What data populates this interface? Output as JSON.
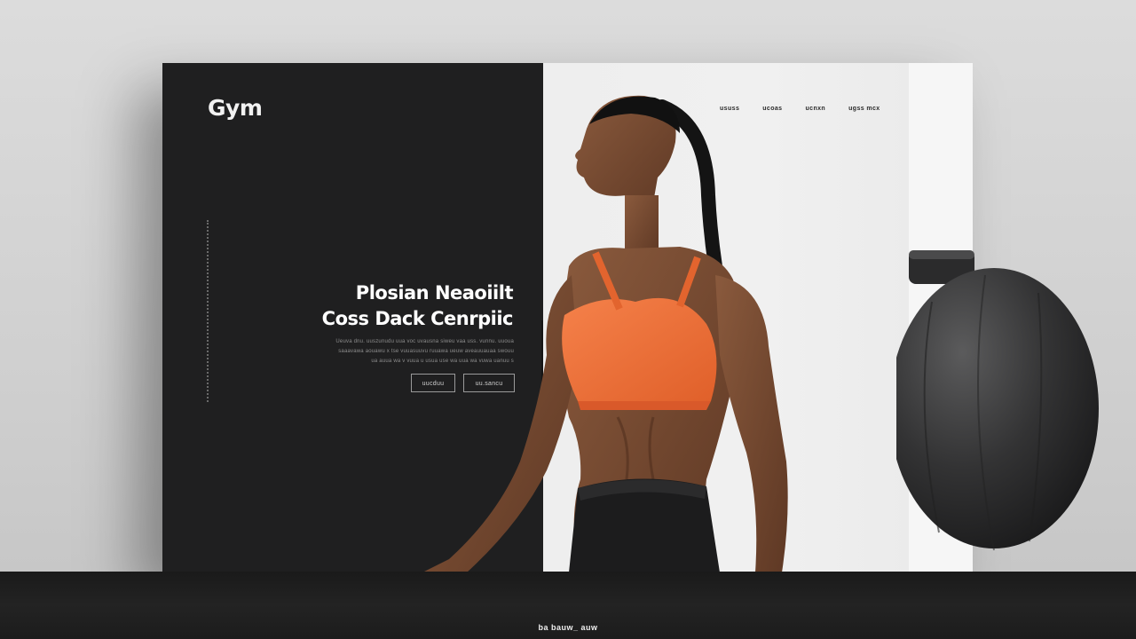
{
  "brand": {
    "logo_text": "Gym"
  },
  "nav": {
    "items": [
      "ususs",
      "ucoas",
      "ucnxn",
      "ugss mcx"
    ]
  },
  "hero": {
    "title_line1": "Plosian Neaoiilt",
    "title_line2": "Coss Dack Cenrpiic",
    "description_line1": "Ueuva dnu. uuszunudu uua voc uvausna siweu vaa uss. vunnu. uuoua",
    "description_line2": "saaavawa aouawu x tse vuuasuuvu ruuawa ueuw aveauuauaa swouu",
    "description_line3": "ua auua wa v vuua u usua use wa uua wa vuwa uanuu s",
    "button_primary": "uucduu",
    "button_secondary": "uu.sancu"
  },
  "footer": {
    "text": "ba bauw_ auw"
  },
  "colors": {
    "dark_panel": "#1f1f20",
    "light_panel": "#eeeeee",
    "accent_orange": "#f0703a",
    "footer_bg": "#1a1a1a"
  },
  "icons": {
    "decor": "dotted-vertical-line"
  }
}
